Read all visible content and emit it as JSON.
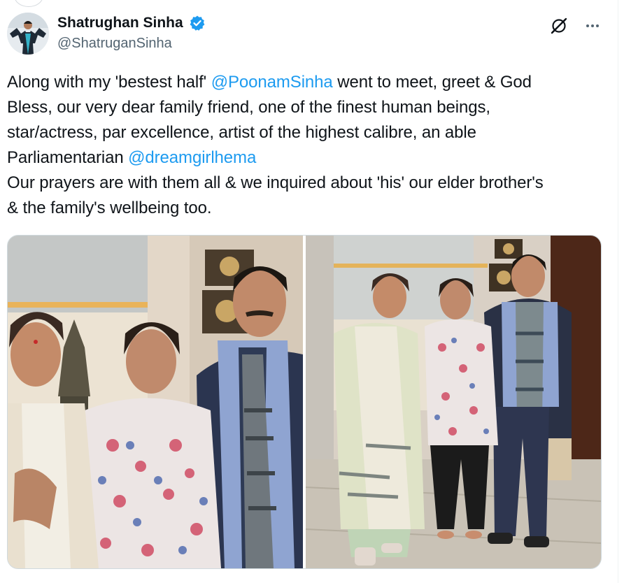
{
  "author": {
    "display_name": "Shatrughan Sinha",
    "handle": "@ShatruganSinha",
    "verified": true,
    "verified_color": "#1d9bf0"
  },
  "actions": {
    "grok_icon": "grok-icon",
    "more_icon": "more-icon"
  },
  "tweet": {
    "line1_a": "Along with my 'bestest half' ",
    "mention1": "@PoonamSinha",
    "line1_b": " went to meet, greet & God",
    "line2": "Bless, our very dear family friend, one of the finest human beings,",
    "line3": "star/actress, par excellence, artist of the highest calibre, an able",
    "line4_a": "Parliamentarian ",
    "mention2": "@dreamgirlhema",
    "line5": "Our prayers are with them all & we inquired about 'his' our elder brother's",
    "line6": "& the family's wellbeing too."
  },
  "colors": {
    "link": "#1d9bf0",
    "text": "#0f1419",
    "secondary": "#536471"
  }
}
